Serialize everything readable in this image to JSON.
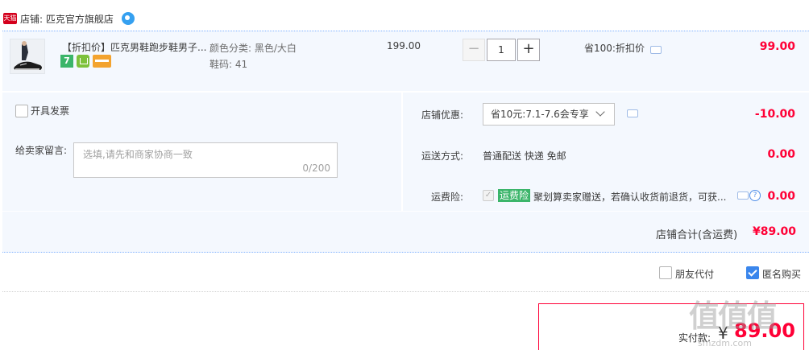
{
  "shop": {
    "badge": "天猫",
    "label": "店铺: 匹克官方旗舰店"
  },
  "item": {
    "title": "【折扣价】匹克男鞋跑步鞋男子...",
    "color": "颜色分类: 黑色/大白",
    "size": "鞋码: 41",
    "unit_price": "199.00",
    "quantity": "1",
    "qty_minus": "−",
    "qty_plus": "+",
    "discount_info": "省100:折扣价",
    "total": "99.00",
    "service_icons": [
      "7-day-return-icon",
      "green-guarantee-icon",
      "card-icon"
    ]
  },
  "invoice": {
    "label": "开具发票"
  },
  "message": {
    "label": "给卖家留言:",
    "placeholder": "选填,请先和商家协商一致",
    "counter": "0/200"
  },
  "promo": {
    "label": "店铺优惠:",
    "selected": "省10元:7.1-7.6会专享",
    "amount": "-10.00"
  },
  "shipping": {
    "label": "运送方式:",
    "value": "普通配送 快递 免邮",
    "amount": "0.00"
  },
  "insurance": {
    "label": "运费险:",
    "tag": "运费险",
    "checkmark": "✓",
    "description": "聚划算卖家赠送，若确认收货前退货，可获...",
    "help": "?",
    "amount": "0.00"
  },
  "shop_total": {
    "label": "店铺合计(含运费)",
    "amount": "¥89.00"
  },
  "options": {
    "friend_pay": "朋友代付",
    "anonymous": "匿名购买"
  },
  "payment": {
    "label": "实付款:",
    "currency": "¥",
    "amount": "89.00"
  },
  "watermark": {
    "main": "值值值",
    "sub": "smzdm.com"
  },
  "colors": {
    "accent": "#ff0036",
    "panel_bg": "#f4f8fe",
    "checkbox_blue": "#3a86ec",
    "tag_green": "#3bb56a"
  }
}
